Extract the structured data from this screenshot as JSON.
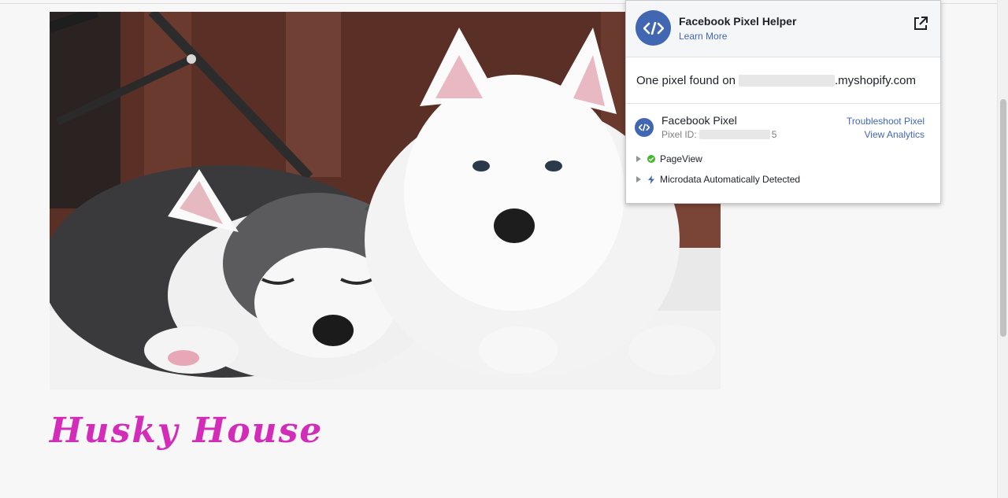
{
  "page": {
    "store_title": "Husky House",
    "hero_image_alt": "two husky puppies"
  },
  "popup": {
    "title": "Facebook Pixel Helper",
    "learn_more": "Learn More",
    "found_prefix": "One pixel found on",
    "found_domain": ".myshopify.com",
    "pixel": {
      "name": "Facebook Pixel",
      "id_label": "Pixel ID:",
      "id_suffix": "5",
      "troubleshoot": "Troubleshoot Pixel",
      "view_analytics": "View Analytics"
    },
    "events": [
      {
        "label": "PageView",
        "icon": "check-circle-icon",
        "color": "#42b72a"
      },
      {
        "label": "Microdata Automatically Detected",
        "icon": "lightning-icon",
        "color": "#4267b2"
      }
    ]
  },
  "colors": {
    "facebook_blue": "#4267b2",
    "store_title": "#d22cb8"
  }
}
